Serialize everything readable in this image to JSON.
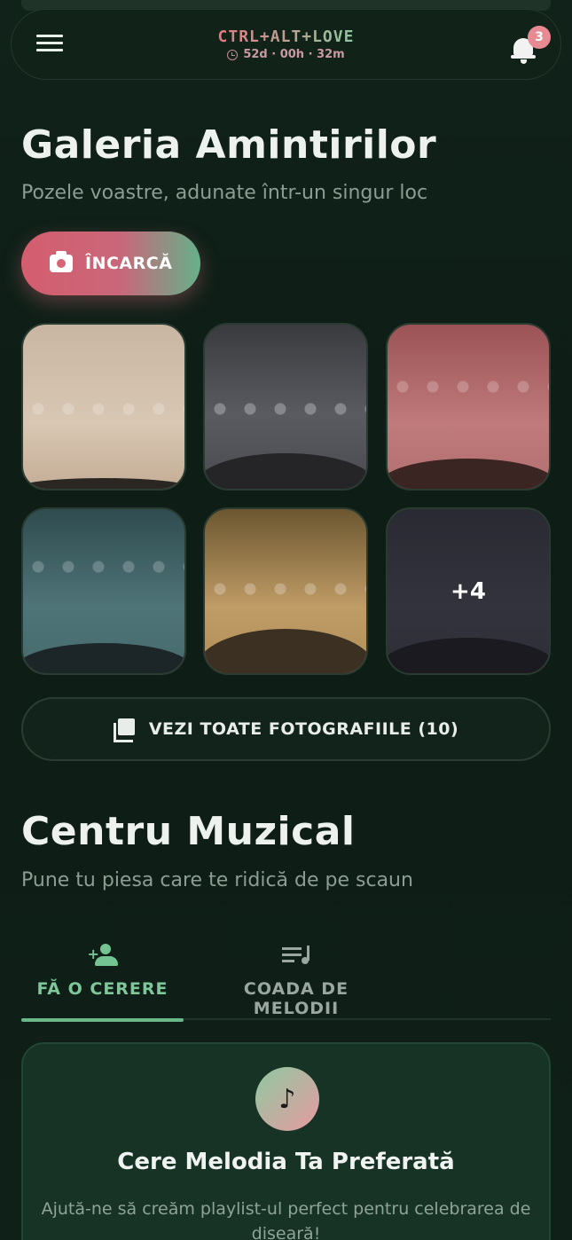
{
  "header": {
    "brand": "CTRL+ALT+LOVE",
    "countdown": "52d · 00h · 32m",
    "notification_count": "3"
  },
  "gallery": {
    "title": "Galeria Amintirilor",
    "subtitle": "Pozele voastre, adunate într-un singur loc",
    "upload_label": "ÎNCARCĂ",
    "more_count": "+4",
    "view_all_label": "VEZI TOATE FOTOGRAFIILE (10)"
  },
  "music": {
    "title": "Centru Muzical",
    "subtitle": "Pune tu piesa care te ridică de pe scaun",
    "tabs": [
      {
        "label": "FĂ O CERERE",
        "icon": "person-add-icon",
        "active": true
      },
      {
        "label": "COADA DE MELODII",
        "icon": "queue-music-icon",
        "active": false
      }
    ],
    "card_title": "Cere Melodia Ta Preferată",
    "card_desc": "Ajută-ne să creăm playlist-ul perfect pentru celebrarea de diseară!"
  },
  "colors": {
    "accent_pink": "#d45d6e",
    "accent_green": "#6ab88a",
    "background": "#0f1f18"
  }
}
